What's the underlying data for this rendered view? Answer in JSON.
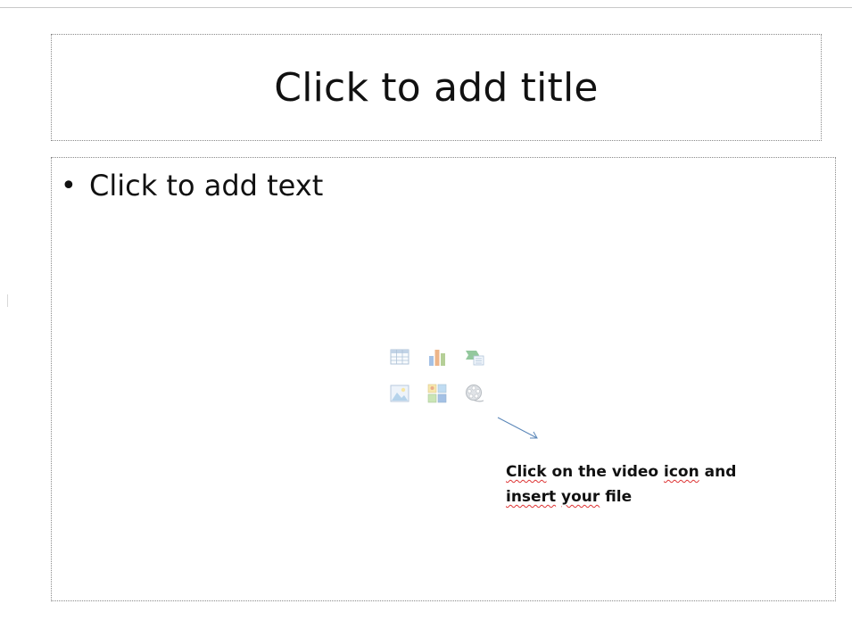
{
  "slide": {
    "title_placeholder": "Click to add title",
    "bullet": "•",
    "text_placeholder": "Click to add text",
    "content_icons": [
      {
        "name": "insert-table-icon"
      },
      {
        "name": "insert-chart-icon"
      },
      {
        "name": "insert-smartart-icon"
      },
      {
        "name": "insert-picture-icon"
      },
      {
        "name": "insert-clipart-icon"
      },
      {
        "name": "insert-media-clip-icon"
      }
    ],
    "note": {
      "w1": "Click",
      "w2": "on the video",
      "w3": "icon",
      "w4": "and",
      "w5": "insert",
      "w6": "your",
      "w7": "file"
    }
  }
}
